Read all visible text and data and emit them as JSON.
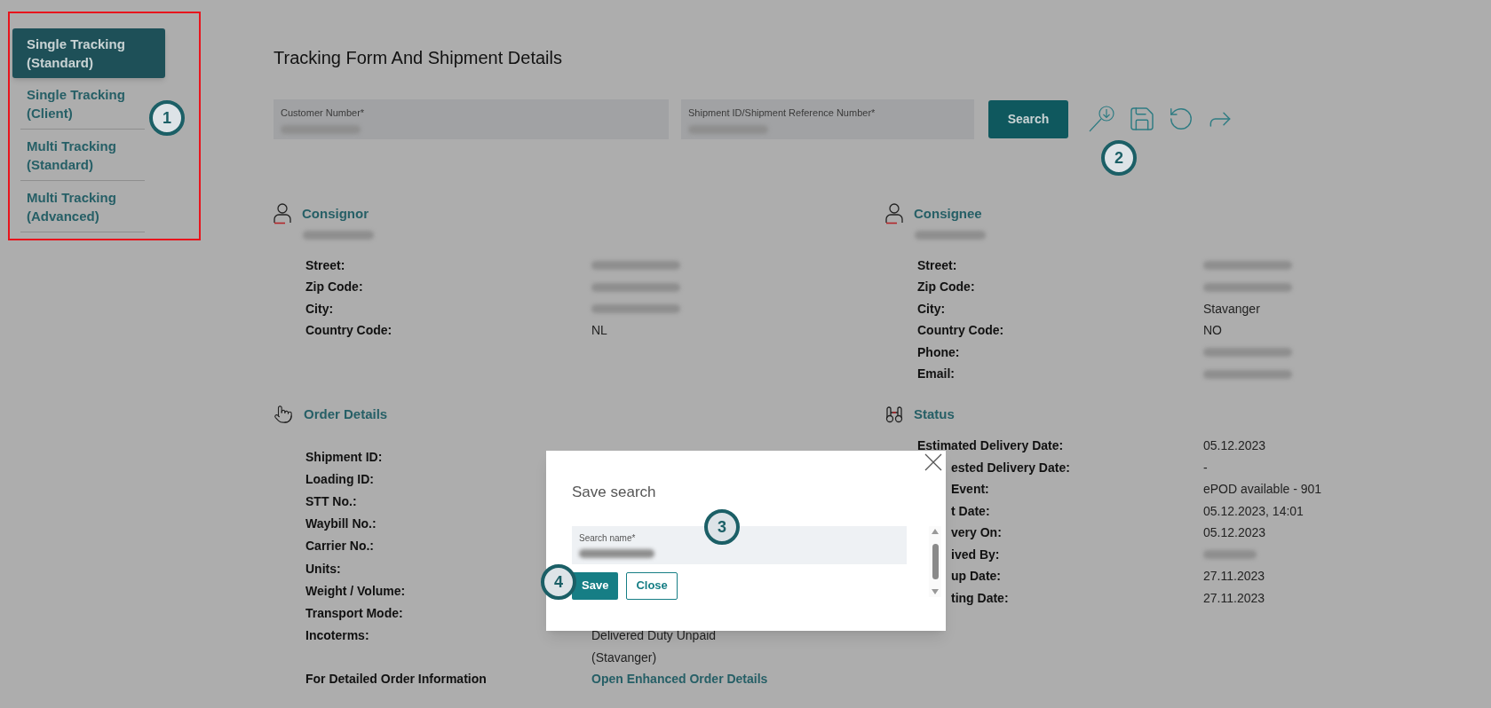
{
  "sidebar": {
    "items": [
      {
        "label": "Single Tracking (Standard)",
        "selected": true
      },
      {
        "label": "Single Tracking (Client)",
        "selected": false
      },
      {
        "label": "Multi Tracking (Standard)",
        "selected": false
      },
      {
        "label": "Multi Tracking (Advanced)",
        "selected": false
      }
    ]
  },
  "page_title": "Tracking Form And Shipment Details",
  "form": {
    "fields": [
      {
        "label": "Customer Number*",
        "redacted": true
      },
      {
        "label": "Shipment ID/Shipment Reference Number*",
        "redacted": true
      }
    ],
    "search_button": "Search",
    "toolbar": [
      {
        "kind": "search-download"
      },
      {
        "kind": "save"
      },
      {
        "kind": "reload"
      },
      {
        "kind": "share"
      }
    ]
  },
  "consignor": {
    "title": "Consignor",
    "name_redacted": true,
    "rows": [
      {
        "label": "Street:",
        "redacted": true
      },
      {
        "label": "Zip Code:",
        "redacted": true
      },
      {
        "label": "City:",
        "redacted": true
      },
      {
        "label": "Country Code:",
        "value": "NL"
      }
    ]
  },
  "consignee": {
    "title": "Consignee",
    "name_redacted": true,
    "rows": [
      {
        "label": "Street:",
        "redacted": true
      },
      {
        "label": "Zip Code:",
        "redacted": true
      },
      {
        "label": "City:",
        "value": "Stavanger"
      },
      {
        "label": "Country Code:",
        "value": "NO"
      },
      {
        "label": "Phone:",
        "redacted": true
      },
      {
        "label": "Email:",
        "redacted": true
      }
    ]
  },
  "order_details": {
    "title": "Order Details",
    "rows": [
      {
        "label": "Shipment ID:"
      },
      {
        "label": "Loading ID:"
      },
      {
        "label": "STT No.:"
      },
      {
        "label": "Waybill No.:"
      },
      {
        "label": "Carrier No.:"
      },
      {
        "label": "Units:"
      },
      {
        "label": "Weight / Volume:"
      },
      {
        "label": "Transport Mode:"
      },
      {
        "label": "Incoterms:",
        "value": "Delivered Duty Unpaid",
        "value_line_2": "(Stavanger)"
      }
    ],
    "link_label": "For Detailed Order Information",
    "link": "Open Enhanced Order Details"
  },
  "status": {
    "title": "Status",
    "rows": [
      {
        "label": "Estimated Delivery Date:",
        "cut": false,
        "value": "05.12.2023"
      },
      {
        "label": "ested Delivery Date:",
        "cut": true,
        "value": "-"
      },
      {
        "label": "Event:",
        "cut": true,
        "value": "ePOD available - 901"
      },
      {
        "label": "t Date:",
        "cut": true,
        "value": "05.12.2023, 14:01"
      },
      {
        "label": "very On:",
        "cut": true,
        "value": "05.12.2023"
      },
      {
        "label": "ived By:",
        "cut": true,
        "redacted": true
      },
      {
        "label": "up Date:",
        "cut": true,
        "value": "27.11.2023"
      },
      {
        "label": "ting Date:",
        "cut": true,
        "value": "27.11.2023"
      }
    ]
  },
  "dialog": {
    "title": "Save search",
    "field": {
      "label": "Search name*",
      "redacted": true
    },
    "buttons": [
      {
        "label": "Save",
        "kind": "primary"
      },
      {
        "label": "Close",
        "kind": "secondary"
      }
    ]
  },
  "annotations": [
    {
      "number": "1"
    },
    {
      "number": "2"
    },
    {
      "number": "3"
    },
    {
      "number": "4"
    }
  ]
}
